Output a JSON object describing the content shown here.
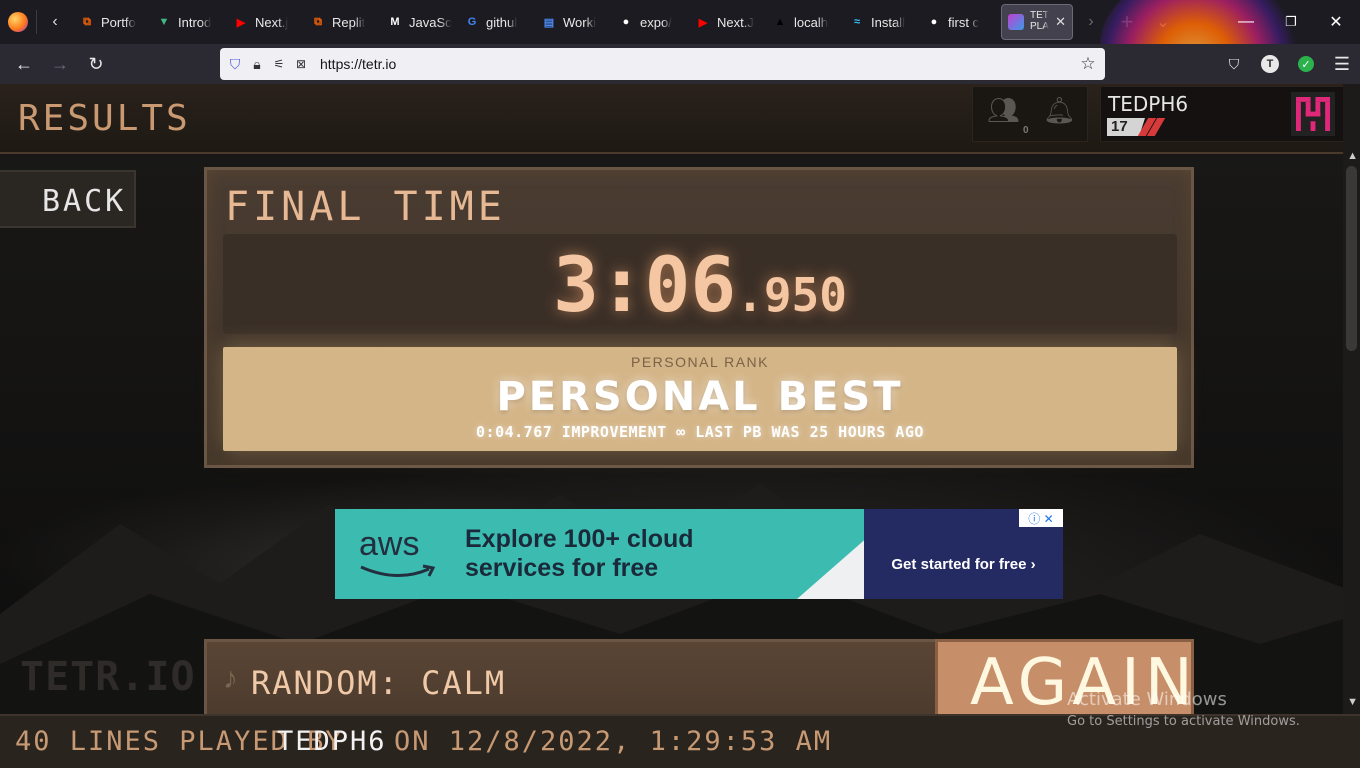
{
  "browser": {
    "tabs": [
      {
        "label": "Portfo",
        "icon": "replit-icon",
        "color": "#f26207"
      },
      {
        "label": "Introd",
        "icon": "vue-icon",
        "color": "#41b883"
      },
      {
        "label": "Next.j",
        "icon": "youtube-icon",
        "color": "#ff0000"
      },
      {
        "label": "Replit",
        "icon": "replit-icon",
        "color": "#f26207"
      },
      {
        "label": "JavaSc",
        "icon": "mdn-icon",
        "color": "#ffffff"
      },
      {
        "label": "githul",
        "icon": "google-icon",
        "color": "#4285f4"
      },
      {
        "label": "Worki",
        "icon": "docs-icon",
        "color": "#4c8bf5"
      },
      {
        "label": "expo/",
        "icon": "github-icon",
        "color": "#ffffff"
      },
      {
        "label": "Next.J",
        "icon": "youtube-icon",
        "color": "#ff0000"
      },
      {
        "label": "localh",
        "icon": "vercel-icon",
        "color": "#000000"
      },
      {
        "label": "Install",
        "icon": "tailwind-icon",
        "color": "#38bdf8"
      },
      {
        "label": "first c",
        "icon": "github-icon",
        "color": "#ffffff"
      }
    ],
    "active_tab": {
      "label": "TETR.IO PLAY",
      "icon": "tetrio-icon"
    },
    "url": "https://tetr.io"
  },
  "app": {
    "header_title": "RESULTS",
    "notification_count": "0",
    "user": {
      "name": "TEDPH6",
      "level": "17"
    },
    "back_label": "BACK",
    "final_time_label": "FINAL TIME",
    "time_main": "3:06",
    "time_ms": ".950",
    "personal_rank_label": "PERSONAL RANK",
    "personal_rank_value": "PERSONAL BEST",
    "improvement": "0:04.767 IMPROVEMENT ∞ LAST PB WAS 25 HOURS AGO",
    "music_label": "RANDOM: CALM",
    "again_label": "AGAIN",
    "logo_text": "TETR.IO",
    "footer": {
      "part1": "40 LINES PLAYED BY",
      "player": "TEDPH6",
      "part2": "ON 12/8/2022, 1:29:53 AM"
    }
  },
  "ad": {
    "brand": "aws",
    "headline": "Explore 100+ cloud services for free",
    "cta": "Get started for free ›",
    "choice_icons": "ⓘ ✕"
  },
  "windows_watermark": {
    "title": "Activate Windows",
    "subtitle": "Go to Settings to activate Windows."
  },
  "colors": {
    "accent": "#c99a72",
    "time_glow": "#f4c6a2",
    "rank_bg": "#d4b588",
    "again_bg": "#c68e69",
    "ad_bg": "#3cbcb1",
    "ad_cta_bg": "#232b62"
  }
}
